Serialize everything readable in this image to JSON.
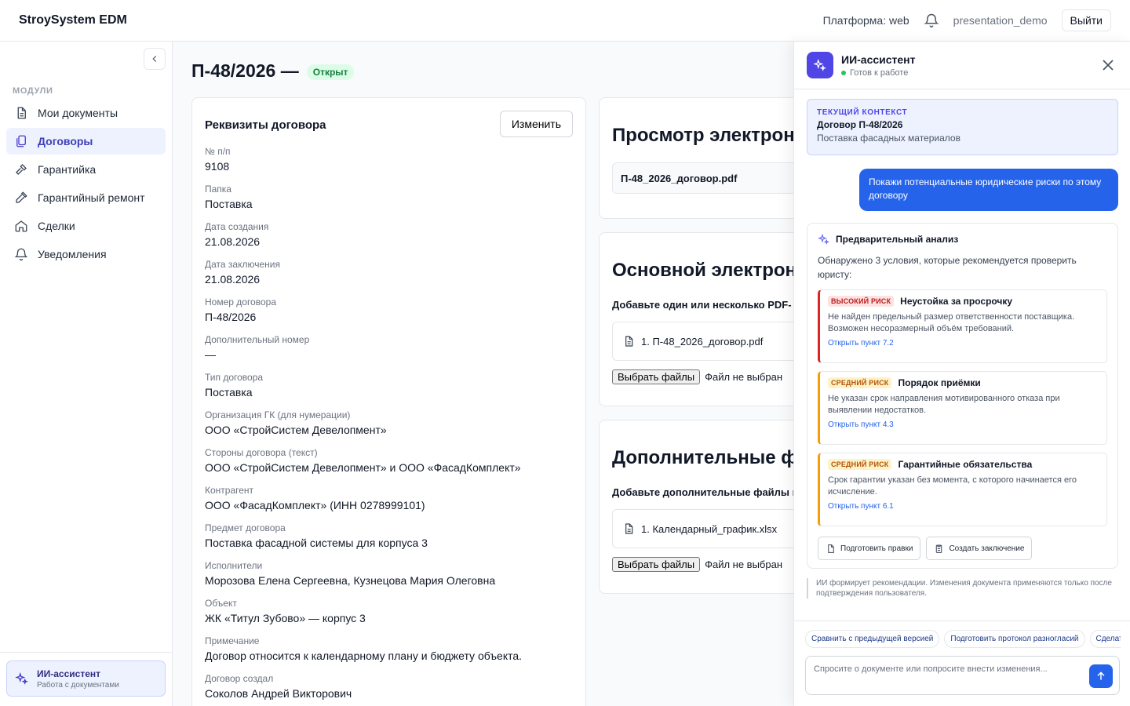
{
  "header": {
    "brand": "StroySystem EDM",
    "platform": "Платформа: web",
    "user": "presentation_demo",
    "logout": "Выйти"
  },
  "sidebar": {
    "section": "МОДУЛИ",
    "items": [
      {
        "label": "Мои документы",
        "icon": "document-icon"
      },
      {
        "label": "Договоры",
        "icon": "contracts-icon",
        "active": true
      },
      {
        "label": "Гарантийка",
        "icon": "hammer-icon"
      },
      {
        "label": "Гарантийный ремонт",
        "icon": "wrench-icon"
      },
      {
        "label": "Сделки",
        "icon": "home-icon"
      },
      {
        "label": "Уведомления",
        "icon": "bell-icon"
      }
    ],
    "ai": {
      "title": "ИИ-ассистент",
      "subtitle": "Работа с документами"
    }
  },
  "page": {
    "title": "П-48/2026 —",
    "status": "Открыт"
  },
  "details": {
    "title": "Реквизиты договора",
    "edit": "Изменить",
    "fields": [
      {
        "label": "№ п/п",
        "value": "9108"
      },
      {
        "label": "Папка",
        "value": "Поставка"
      },
      {
        "label": "Дата создания",
        "value": "21.08.2026"
      },
      {
        "label": "Дата заключения",
        "value": "21.08.2026"
      },
      {
        "label": "Номер договора",
        "value": "П-48/2026"
      },
      {
        "label": "Дополнительный номер",
        "value": "—"
      },
      {
        "label": "Тип договора",
        "value": "Поставка"
      },
      {
        "label": "Организация ГК (для нумерации)",
        "value": "ООО «СтройСистем Девелопмент»"
      },
      {
        "label": "Стороны договора (текст)",
        "value": "ООО «СтройСистем Девелопмент» и ООО «ФасадКомплект»"
      },
      {
        "label": "Контрагент",
        "value": "ООО «ФасадКомплект» (ИНН 0278999101)"
      },
      {
        "label": "Предмет договора",
        "value": "Поставка фасадной системы для корпуса 3"
      },
      {
        "label": "Исполнители",
        "value": "Морозова Елена Сергеевна, Кузнецова Мария Олеговна"
      },
      {
        "label": "Объект",
        "value": "ЖК «Титул Зубово» — корпус 3"
      },
      {
        "label": "Примечание",
        "value": "Договор относится к календарному плану и бюджету объекта."
      },
      {
        "label": "Договор создал",
        "value": "Соколов Андрей Викторович"
      }
    ]
  },
  "preview": {
    "title": "Просмотр электрон",
    "file": "П-48_2026_договор.pdf"
  },
  "main_file": {
    "title": "Основной электрон",
    "hint": "Добавьте один или несколько PDF-",
    "item": "1. П-48_2026_договор.pdf",
    "choose": "Выбрать файлы",
    "none": "Файл не выбран"
  },
  "extra_files": {
    "title": "Дополнительные фа",
    "hint": "Добавьте дополнительные файлы и",
    "item": "1. Календарный_график.xlsx",
    "choose": "Выбрать файлы",
    "none": "Файл не выбран"
  },
  "ai": {
    "title": "ИИ-ассистент",
    "status": "Готов к работе",
    "context": {
      "key": "ТЕКУЩИЙ КОНТЕКСТ",
      "name": "Договор П-48/2026",
      "sub": "Поставка фасадных материалов"
    },
    "user_msg": "Покажи потенциальные юридические риски по этому договору",
    "analysis": {
      "title": "Предварительный анализ",
      "intro": "Обнаружено 3 условия, которые рекомендуется проверить юристу:",
      "risks": [
        {
          "tag": "ВЫСОКИЙ РИСК",
          "title": "Неустойка за просрочку",
          "desc": "Не найден предельный размер ответственности поставщика. Возможен несоразмерный объём требований.",
          "link": "Открыть пункт 7.2",
          "color": "#dc2626"
        },
        {
          "tag": "СРЕДНИЙ РИСК",
          "title": "Порядок приёмки",
          "desc": "Не указан срок направления мотивированного отказа при выявлении недостатков.",
          "link": "Открыть пункт 4.3",
          "color": "#f59e0b"
        },
        {
          "tag": "СРЕДНИЙ РИСК",
          "title": "Гарантийные обязательства",
          "desc": "Срок гарантии указан без момента, с которого начинается его исчисление.",
          "link": "Открыть пункт 6.1",
          "color": "#f59e0b"
        }
      ],
      "btn_edits": "Подготовить правки",
      "btn_conclusion": "Создать заключение"
    },
    "disclaimer": "ИИ формирует рекомендации. Изменения документа применяются только после подтверждения пользователя.",
    "suggestions": [
      "Сравнить с предыдущей версией",
      "Подготовить протокол разногласий",
      "Сделать резюме"
    ],
    "placeholder": "Спросите о документе или попросите внести изменения..."
  }
}
